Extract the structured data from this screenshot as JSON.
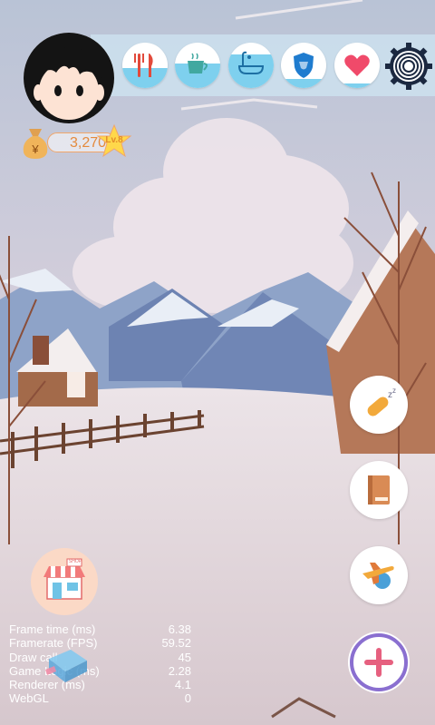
{
  "hud": {
    "coins": "3,270",
    "level": "Lv.8"
  },
  "status_icons": [
    {
      "name": "food",
      "icon": "fork-knife-icon",
      "fill_level": 0.45
    },
    {
      "name": "drink",
      "icon": "cup-icon",
      "fill_level": 0.55
    },
    {
      "name": "clean",
      "icon": "bathtub-icon",
      "fill_level": 0.75
    },
    {
      "name": "health",
      "icon": "shield-icon",
      "fill_level": 0.2
    },
    {
      "name": "mood",
      "icon": "heart-icon",
      "fill_level": 0.1
    }
  ],
  "side_buttons": [
    {
      "name": "sleep",
      "icon": "sleep-pill-icon"
    },
    {
      "name": "book",
      "icon": "book-icon"
    },
    {
      "name": "travel",
      "icon": "airplane-icon"
    }
  ],
  "shop": {
    "icon": "shop-icon",
    "sign": "SHOP"
  },
  "stats": [
    {
      "label": "Frame time (ms)",
      "value": "6.38"
    },
    {
      "label": "Framerate (FPS)",
      "value": "59.52"
    },
    {
      "label": "Draw call",
      "value": "45"
    },
    {
      "label": "Game Logic (ms)",
      "value": "2.28"
    },
    {
      "label": "Renderer (ms)",
      "value": "4.1"
    },
    {
      "label": "WebGL",
      "value": "0"
    }
  ],
  "colors": {
    "status_fill": "#7ed0ee",
    "accent_orange": "#f1a66a",
    "add_ring": "#8a6fd0",
    "add_plus": "#e6607f"
  }
}
